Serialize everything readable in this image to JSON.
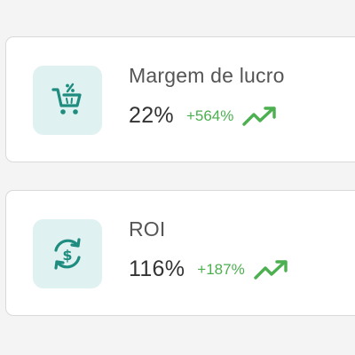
{
  "colors": {
    "accent": "#1e8c7e",
    "tile_background": "#dff1f0",
    "positive": "#4caf50"
  },
  "cards": [
    {
      "title": "Margem de lucro",
      "value": "22%",
      "delta": "+564%",
      "icon": "cart-percent-icon",
      "trend_icon": "trending-up-icon"
    },
    {
      "title": "ROI",
      "value": "116%",
      "delta": "+187%",
      "icon": "currency-exchange-icon",
      "trend_icon": "trending-up-icon"
    }
  ]
}
